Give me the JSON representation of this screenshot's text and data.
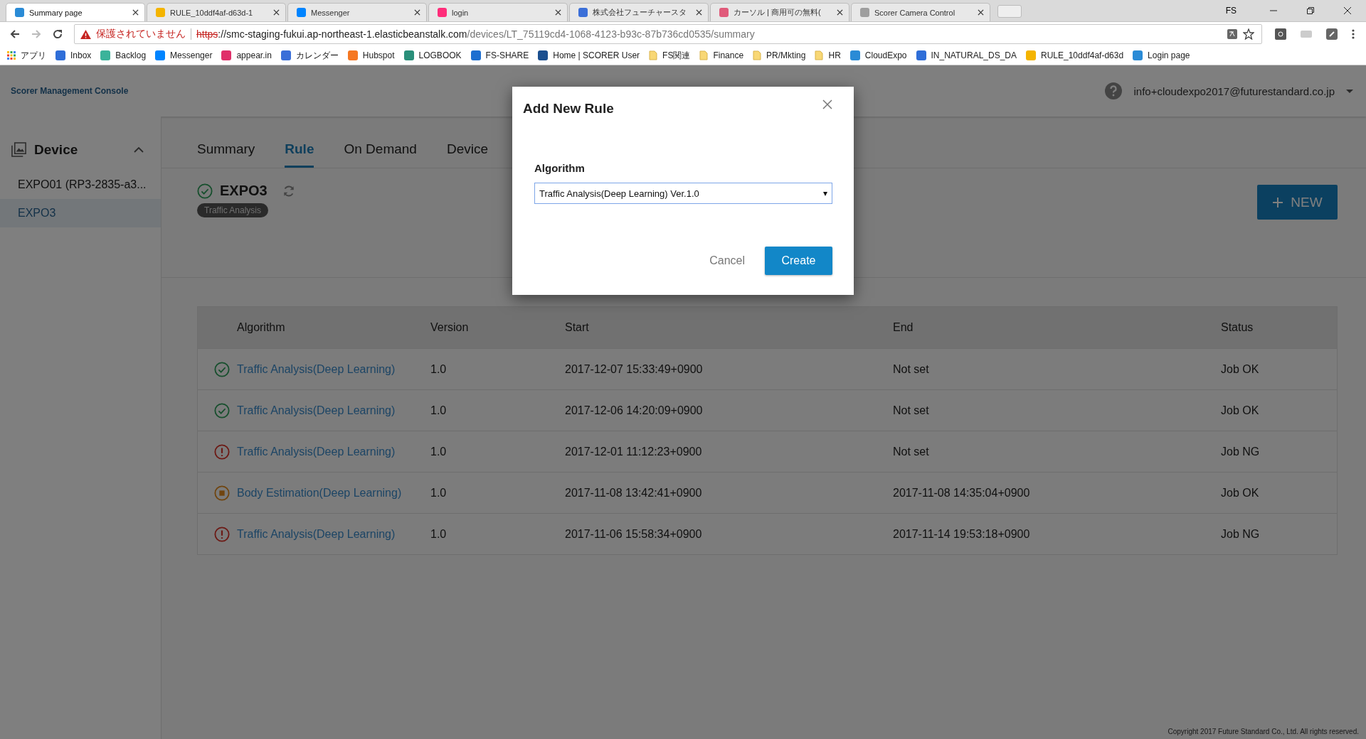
{
  "browser": {
    "tabs": [
      {
        "title": "Summary page",
        "selected": true,
        "color": "#2a8bd6"
      },
      {
        "title": "RULE_10ddf4af-d63d-1",
        "selected": false,
        "color": "#f4b400"
      },
      {
        "title": "Messenger",
        "selected": false,
        "color": "#0084ff"
      },
      {
        "title": "login",
        "selected": false,
        "color": "#ff2d7a"
      },
      {
        "title": "株式会社フューチャースタ",
        "selected": false,
        "color": "#3b6fd8"
      },
      {
        "title": "カーソル | 商用可の無料(",
        "selected": false,
        "color": "#e05a7a"
      },
      {
        "title": "Scorer Camera Control",
        "selected": false,
        "color": "#9e9e9e"
      }
    ],
    "profile": "FS",
    "security_warning": "保護されていません",
    "url_scheme": "https",
    "url_host": "://smc-staging-fukui.ap-northeast-1.elasticbeanstalk.com",
    "url_path": "/devices/LT_75119cd4-1068-4123-b93c-87b736cd0535/summary",
    "bookmarks": [
      {
        "label": "アプリ",
        "kind": "apps"
      },
      {
        "label": "Inbox",
        "kind": "site",
        "color": "#2f6ed8"
      },
      {
        "label": "Backlog",
        "kind": "site",
        "color": "#3bb39a"
      },
      {
        "label": "Messenger",
        "kind": "site",
        "color": "#0084ff"
      },
      {
        "label": "appear.in",
        "kind": "site",
        "color": "#e0306a"
      },
      {
        "label": "カレンダー",
        "kind": "site",
        "color": "#3b6fd8"
      },
      {
        "label": "Hubspot",
        "kind": "site",
        "color": "#f57722"
      },
      {
        "label": "LOGBOOK",
        "kind": "site",
        "color": "#2a8f7a"
      },
      {
        "label": "FS-SHARE",
        "kind": "site",
        "color": "#1e6fd0"
      },
      {
        "label": "Home | SCORER User",
        "kind": "site",
        "color": "#1b4f8f"
      },
      {
        "label": "FS関連",
        "kind": "folder"
      },
      {
        "label": "Finance",
        "kind": "folder"
      },
      {
        "label": "PR/Mkting",
        "kind": "folder"
      },
      {
        "label": "HR",
        "kind": "folder"
      },
      {
        "label": "CloudExpo",
        "kind": "site",
        "color": "#2a8bd6"
      },
      {
        "label": "IN_NATURAL_DS_DA",
        "kind": "site",
        "color": "#2f6ed8"
      },
      {
        "label": "RULE_10ddf4af-d63d",
        "kind": "site",
        "color": "#f4b400"
      },
      {
        "label": "Login page",
        "kind": "site",
        "color": "#2a8bd6"
      }
    ]
  },
  "app": {
    "brand": "Scorer Management Console",
    "user": "info+cloudexpo2017@futurestandard.co.jp",
    "sidebar": {
      "title": "Device",
      "expanded": true,
      "items": [
        {
          "label": "EXPO01 (RP3-2835-a3...",
          "selected": false
        },
        {
          "label": "EXPO3",
          "selected": true
        }
      ]
    },
    "tabs": [
      {
        "label": "Summary",
        "selected": false
      },
      {
        "label": "Rule",
        "selected": true
      },
      {
        "label": "On Demand",
        "selected": false
      },
      {
        "label": "Device",
        "selected": false
      }
    ],
    "device": {
      "name": "EXPO3",
      "tag": "Traffic Analysis"
    },
    "new_button": "NEW",
    "table": {
      "columns": [
        "Algorithm",
        "Version",
        "Start",
        "End",
        "Status"
      ],
      "rows": [
        {
          "kind": "ok",
          "algorithm": "Traffic Analysis(Deep Learning)",
          "version": "1.0",
          "start": "2017-12-07 15:33:49+0900",
          "end": "Not set",
          "status": "Job OK"
        },
        {
          "kind": "ok",
          "algorithm": "Traffic Analysis(Deep Learning)",
          "version": "1.0",
          "start": "2017-12-06 14:20:09+0900",
          "end": "Not set",
          "status": "Job OK"
        },
        {
          "kind": "error",
          "algorithm": "Traffic Analysis(Deep Learning)",
          "version": "1.0",
          "start": "2017-12-01 11:12:23+0900",
          "end": "Not set",
          "status": "Job NG"
        },
        {
          "kind": "stopped",
          "algorithm": "Body Estimation(Deep Learning)",
          "version": "1.0",
          "start": "2017-11-08 13:42:41+0900",
          "end": "2017-11-08 14:35:04+0900",
          "status": "Job OK"
        },
        {
          "kind": "error",
          "algorithm": "Traffic Analysis(Deep Learning)",
          "version": "1.0",
          "start": "2017-11-06 15:58:34+0900",
          "end": "2017-11-14 19:53:18+0900",
          "status": "Job NG"
        }
      ]
    },
    "copyright": "Copyright 2017 Future Standard Co., Ltd. All rights reserved."
  },
  "dialog": {
    "title": "Add New Rule",
    "field_label": "Algorithm",
    "value": "Traffic Analysis(Deep Learning) Ver.1.0",
    "caret": "▾",
    "buttons": [
      {
        "label": "Cancel",
        "kind": "secondary"
      },
      {
        "label": "Create",
        "kind": "primary"
      }
    ]
  }
}
